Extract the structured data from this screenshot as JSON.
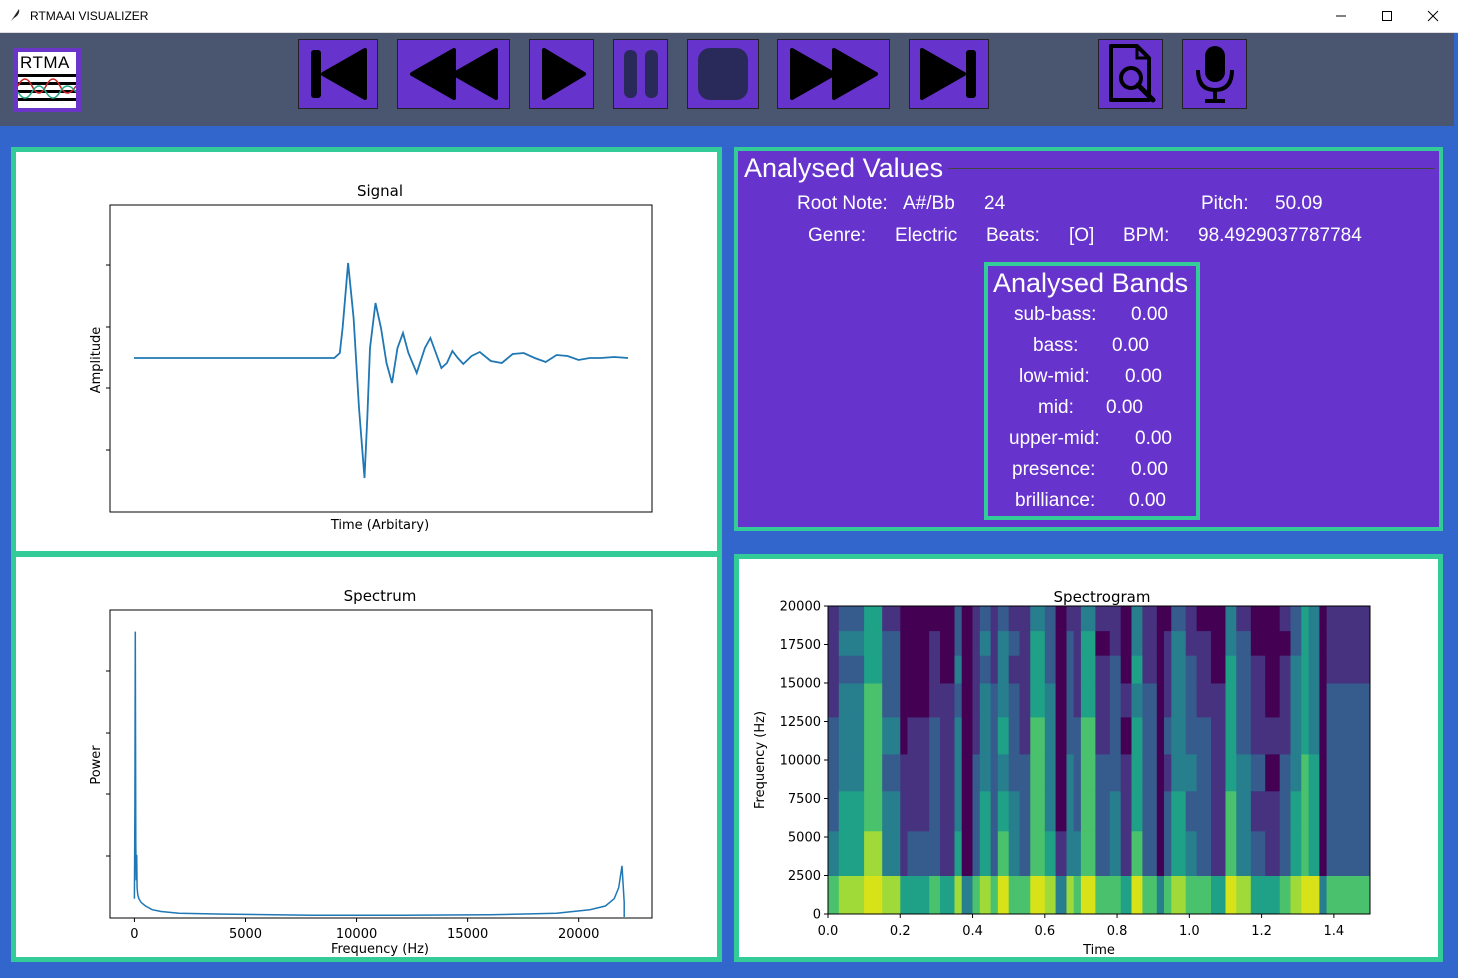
{
  "window": {
    "title": "RTMAAI VISUALIZER",
    "minimize_glyph": "—",
    "maximize_glyph": "☐",
    "close_glyph": "✕"
  },
  "toolbar": {
    "logo_text": "RTMA",
    "buttons": [
      {
        "name": "skip-to-start",
        "icon": "skip-back-icon"
      },
      {
        "name": "rewind",
        "icon": "rewind-icon"
      },
      {
        "name": "play",
        "icon": "play-icon"
      },
      {
        "name": "pause",
        "icon": "pause-icon"
      },
      {
        "name": "stop",
        "icon": "stop-icon"
      },
      {
        "name": "fast-forward",
        "icon": "fast-forward-icon"
      },
      {
        "name": "skip-to-end",
        "icon": "skip-forward-icon"
      },
      {
        "name": "open-file",
        "icon": "file-search-icon"
      },
      {
        "name": "microphone",
        "icon": "microphone-icon"
      }
    ],
    "accent": "#6633cc",
    "bar_color": "#4a5570"
  },
  "analysed_values": {
    "title": "Analysed Values",
    "root_note_label": "Root Note:",
    "root_note_value": "A#/Bb",
    "root_note_index": "24",
    "pitch_label": "Pitch:",
    "pitch_value": "50.09",
    "genre_label": "Genre:",
    "genre_value": "Electric",
    "beats_label": "Beats:",
    "beats_value": "[O]",
    "bpm_label": "BPM:",
    "bpm_value": "98.4929037787784"
  },
  "analysed_bands": {
    "title": "Analysed Bands",
    "bands": [
      {
        "label": "sub-bass:",
        "value": "0.00"
      },
      {
        "label": "bass:",
        "value": "0.00"
      },
      {
        "label": "low-mid:",
        "value": "0.00"
      },
      {
        "label": "mid:",
        "value": "0.00"
      },
      {
        "label": "upper-mid:",
        "value": "0.00"
      },
      {
        "label": "presence:",
        "value": "0.00"
      },
      {
        "label": "brilliance:",
        "value": "0.00"
      }
    ]
  },
  "chart_data": [
    {
      "type": "line",
      "title": "Signal",
      "xlabel": "Time (Arbitary)",
      "ylabel": "Amplitude",
      "x_ticks_shown": false,
      "y_ticks_shown": false,
      "series_color": "#1f77b4",
      "x": [
        0,
        15,
        30,
        45,
        60,
        73,
        75,
        76,
        78,
        80,
        82,
        84,
        85,
        86,
        88,
        90,
        92,
        94,
        96,
        98,
        100,
        103,
        106,
        108,
        110,
        112,
        114,
        116,
        118,
        120,
        123,
        126,
        130,
        134,
        138,
        142,
        146,
        150,
        154,
        158,
        162,
        166,
        170,
        175,
        180
      ],
      "values": [
        0,
        0,
        0,
        0,
        0,
        0,
        0.05,
        0.3,
        0.95,
        0.4,
        -0.5,
        -1.2,
        -0.6,
        0.1,
        0.55,
        0.3,
        -0.05,
        -0.25,
        0.1,
        0.25,
        0.05,
        -0.15,
        0.1,
        0.2,
        0.05,
        -0.1,
        -0.05,
        0.07,
        0.0,
        -0.06,
        0.02,
        0.06,
        -0.03,
        -0.05,
        0.04,
        0.05,
        0.0,
        -0.04,
        0.03,
        0.02,
        -0.02,
        0.0,
        0.0,
        0.01,
        0.0
      ]
    },
    {
      "type": "line",
      "title": "Spectrum",
      "xlabel": "Frequency (Hz)",
      "ylabel": "Power",
      "x_ticks": [
        "0",
        "5000",
        "10000",
        "15000",
        "20000"
      ],
      "xlim": [
        -1100,
        23300
      ],
      "series_color": "#1f77b4",
      "x": [
        0,
        20,
        40,
        60,
        80,
        100,
        120,
        150,
        200,
        300,
        500,
        800,
        1200,
        2000,
        4000,
        8000,
        12000,
        16000,
        19000,
        20500,
        21200,
        21600,
        21800,
        21950,
        22050
      ],
      "values": [
        0.05,
        0.3,
        0.78,
        0.2,
        0.1,
        0.17,
        0.08,
        0.06,
        0.05,
        0.04,
        0.03,
        0.02,
        0.015,
        0.01,
        0.008,
        0.005,
        0.005,
        0.006,
        0.01,
        0.02,
        0.03,
        0.05,
        0.08,
        0.14,
        0.04
      ]
    },
    {
      "type": "heatmap",
      "title": "Spectrogram",
      "xlabel": "Time",
      "ylabel": "Frequency (Hz)",
      "x_ticks": [
        "0.0",
        "0.2",
        "0.4",
        "0.6",
        "0.8",
        "1.0",
        "1.2",
        "1.4"
      ],
      "y_ticks": [
        "0",
        "2500",
        "5000",
        "7500",
        "10000",
        "12500",
        "15000",
        "17500",
        "20000"
      ],
      "xlim": [
        0,
        1.5
      ],
      "ylim": [
        0,
        20000
      ],
      "colormap": "viridis",
      "column_times": [
        0,
        0.03,
        0.1,
        0.15,
        0.2,
        0.22,
        0.28,
        0.31,
        0.35,
        0.37,
        0.4,
        0.42,
        0.45,
        0.47,
        0.5,
        0.53,
        0.56,
        0.6,
        0.63,
        0.66,
        0.68,
        0.7,
        0.74,
        0.78,
        0.81,
        0.84,
        0.87,
        0.91,
        0.93,
        0.95,
        0.99,
        1.02,
        1.06,
        1.1,
        1.13,
        1.17,
        1.21,
        1.25,
        1.28,
        1.31,
        1.33,
        1.36,
        1.38
      ],
      "column_levels": [
        0.35,
        0.55,
        0.8,
        0.45,
        0.15,
        0.2,
        0.3,
        0.2,
        0.5,
        0.05,
        0.3,
        0.55,
        0.35,
        0.6,
        0.4,
        0.3,
        0.75,
        0.5,
        0.1,
        0.45,
        0.35,
        0.75,
        0.3,
        0.4,
        0.2,
        0.65,
        0.35,
        0.05,
        0.3,
        0.55,
        0.4,
        0.3,
        0.2,
        0.7,
        0.45,
        0.25,
        0.15,
        0.3,
        0.55,
        0.75,
        0.6,
        0.05,
        0.35
      ]
    }
  ]
}
